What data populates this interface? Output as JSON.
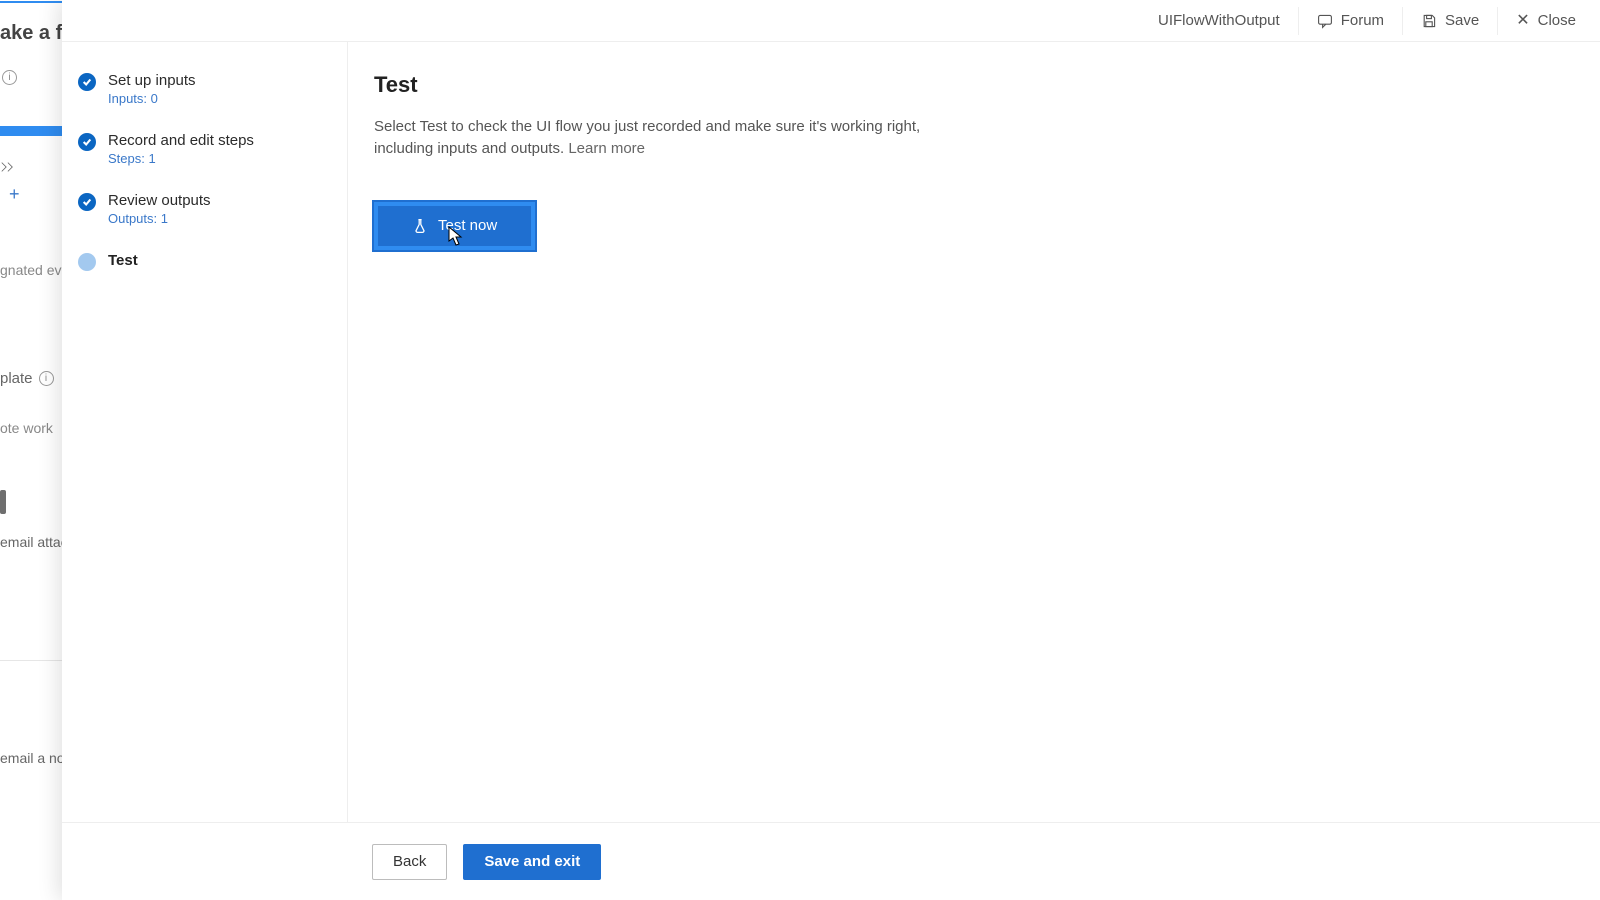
{
  "background": {
    "title_fragment": "ake a flo",
    "help": "i",
    "text1": "gnated even",
    "text2": "plate",
    "info": "i",
    "text3": "ote work",
    "text4": "email attac",
    "text5": "email a no"
  },
  "topbar": {
    "flow_name": "UIFlowWithOutput",
    "forum": "Forum",
    "save": "Save",
    "close": "Close"
  },
  "steps": [
    {
      "title": "Set up inputs",
      "sub": "Inputs: 0",
      "state": "done"
    },
    {
      "title": "Record and edit steps",
      "sub": "Steps: 1",
      "state": "done"
    },
    {
      "title": "Review outputs",
      "sub": "Outputs: 1",
      "state": "done"
    },
    {
      "title": "Test",
      "sub": "",
      "state": "current"
    }
  ],
  "main": {
    "heading": "Test",
    "description": "Select Test to check the UI flow you just recorded and make sure it's working right, including inputs and outputs. ",
    "learn_more": "Learn more",
    "test_now": "Test now"
  },
  "footer": {
    "back": "Back",
    "save_exit": "Save and exit"
  }
}
